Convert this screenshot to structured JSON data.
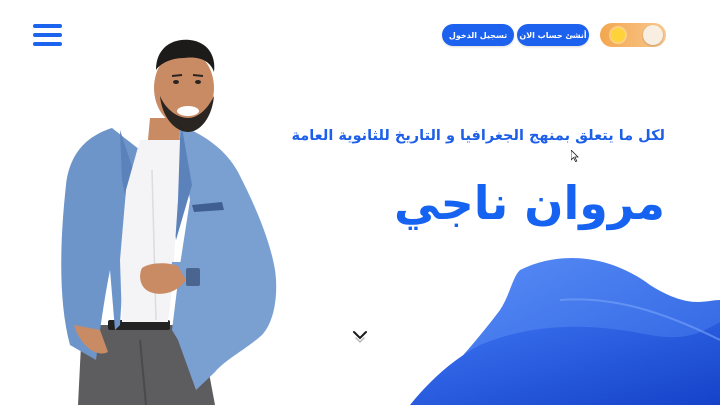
{
  "header": {
    "menu_icon": "hamburger-menu-icon",
    "login_label": "تسجيل الدخول",
    "signup_label": "أنشئ حساب الان",
    "theme_toggle_icon": "sun-icon"
  },
  "hero": {
    "tagline": "لكل ما يتعلق بمنهج الجغرافيا و التاريخ للثانوية العامة",
    "name": "مروان ناجي",
    "scroll_icon": "chevron-down-icon"
  },
  "colors": {
    "primary": "#1d62ee",
    "wave_light": "#4f86f5",
    "wave_dark": "#1a4fd6",
    "toggle": "#f4a64f"
  }
}
